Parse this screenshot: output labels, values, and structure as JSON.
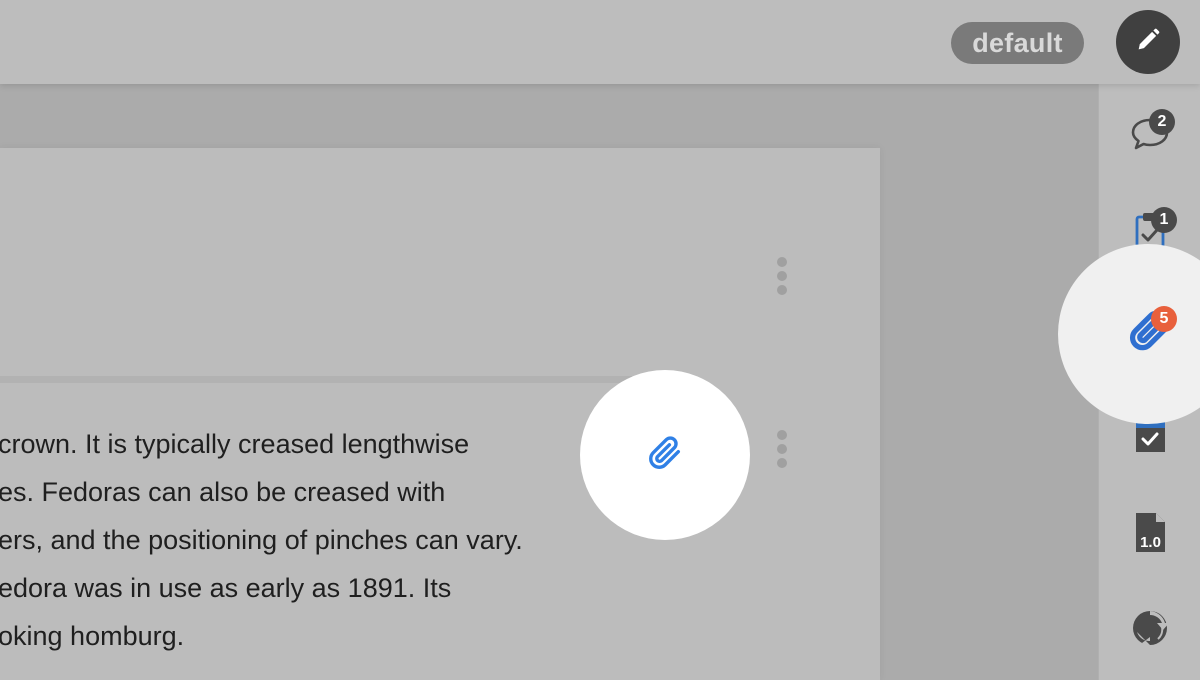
{
  "toolbar": {
    "mode_label": "default",
    "edit_icon": "pencil-icon"
  },
  "document": {
    "paragraph_lines": [
      "crown. It is typically creased lengthwise",
      "es. Fedoras can also be creased with",
      "ers, and the positioning of pinches can vary.",
      "edora was in use as early as 1891. Its",
      "oking homburg."
    ],
    "block_menu_icon": "more-vertical-icon",
    "attach_button_icon": "paperclip-icon"
  },
  "sidebar": {
    "items": [
      {
        "icon": "comment-icon",
        "badge": "2"
      },
      {
        "icon": "task-clipboard-icon",
        "badge": "1"
      },
      {
        "icon": "paperclip-icon",
        "badge": "5"
      },
      {
        "icon": "approval-document-icon"
      },
      {
        "icon": "version-icon",
        "label": "1.0"
      },
      {
        "icon": "sync-icon"
      }
    ]
  },
  "colors": {
    "accent_blue": "#2f80e6",
    "badge_red": "#e8603c",
    "badge_dark": "#4a4a4a"
  }
}
